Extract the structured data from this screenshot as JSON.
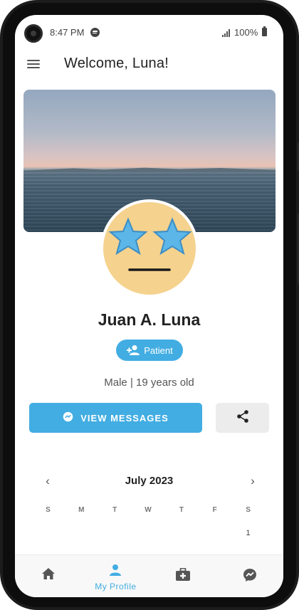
{
  "status_bar": {
    "time": "8:47 PM",
    "battery": "100%"
  },
  "app_bar": {
    "title": "Welcome, Luna!"
  },
  "profile": {
    "name": "Juan A. Luna",
    "role": "Patient",
    "info": "Male | 19 years old"
  },
  "actions": {
    "messages_label": "VIEW MESSAGES"
  },
  "calendar": {
    "month": "July 2023",
    "weekdays": [
      "S",
      "M",
      "T",
      "W",
      "T",
      "F",
      "S"
    ],
    "first_row": [
      "",
      "",
      "",
      "",
      "",
      "",
      "1"
    ]
  },
  "bottom_nav": {
    "items": [
      {
        "icon": "home-icon",
        "label": ""
      },
      {
        "icon": "person-icon",
        "label": "My Profile"
      },
      {
        "icon": "medical-bag-icon",
        "label": ""
      },
      {
        "icon": "messenger-icon",
        "label": ""
      }
    ]
  },
  "colors": {
    "accent": "#42ade2",
    "avatar_bg": "#f5d28e"
  }
}
